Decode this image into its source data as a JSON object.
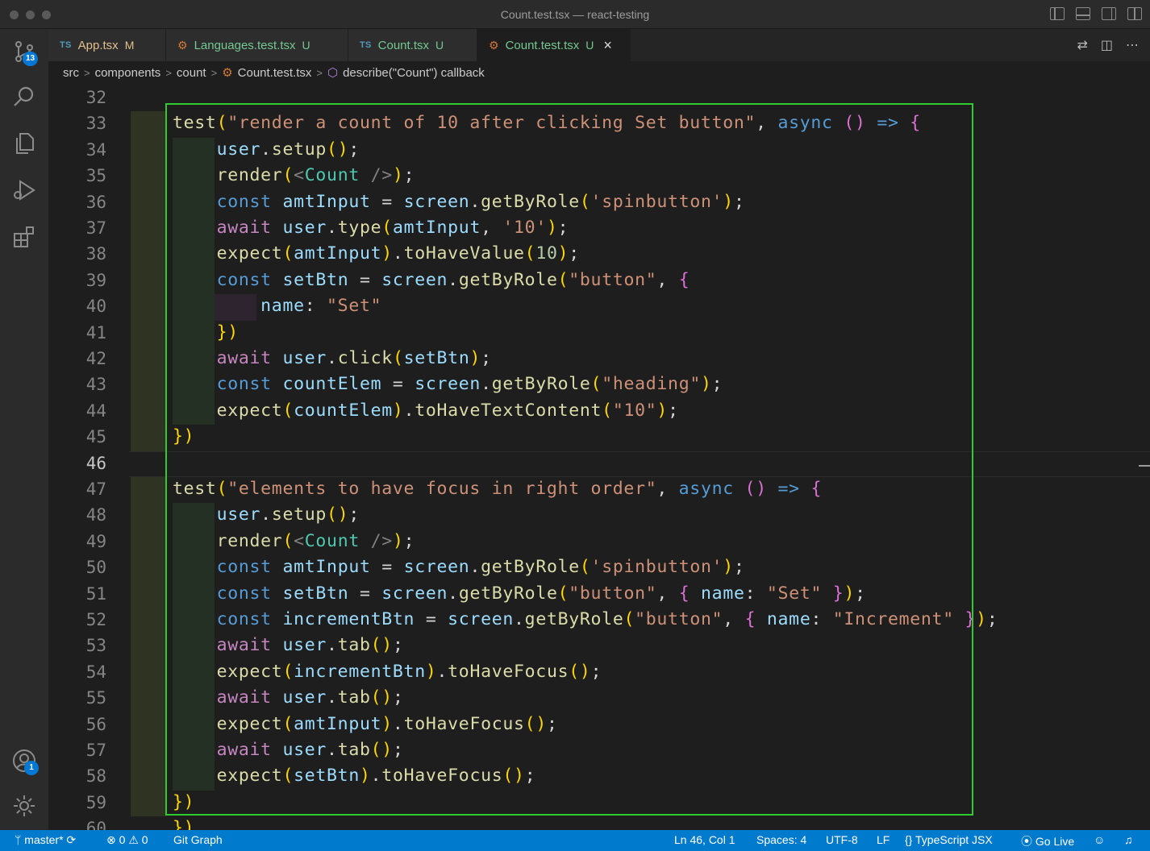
{
  "window": {
    "title": "Count.test.tsx — react-testing"
  },
  "activity_bar": {
    "source_control_badge": "13",
    "accounts_badge": "1"
  },
  "tabs": [
    {
      "lang": "TS",
      "name": "App.tsx",
      "status": "M",
      "active": false
    },
    {
      "lang": "gear",
      "name": "Languages.test.tsx",
      "status": "U",
      "active": false
    },
    {
      "lang": "TS",
      "name": "Count.tsx",
      "status": "U",
      "active": false
    },
    {
      "lang": "gear",
      "name": "Count.test.tsx",
      "status": "U",
      "active": true
    }
  ],
  "breadcrumb": {
    "parts": [
      "src",
      "components",
      "count",
      "Count.test.tsx",
      "describe(\"Count\") callback"
    ]
  },
  "editor": {
    "active_line": "46",
    "line_numbers": [
      "32",
      "33",
      "34",
      "35",
      "36",
      "37",
      "38",
      "39",
      "40",
      "41",
      "42",
      "43",
      "44",
      "45",
      "46",
      "47",
      "48",
      "49",
      "50",
      "51",
      "52",
      "53",
      "54",
      "55",
      "56",
      "57",
      "58",
      "59",
      "60"
    ],
    "lines": [
      "",
      "test(\"render a count of 10 after clicking Set button\", async () => {",
      "    user.setup();",
      "    render(<Count />);",
      "    const amtInput = screen.getByRole('spinbutton');",
      "    await user.type(amtInput, '10');",
      "    expect(amtInput).toHaveValue(10);",
      "    const setBtn = screen.getByRole(\"button\", {",
      "        name: \"Set\"",
      "    })",
      "    await user.click(setBtn);",
      "    const countElem = screen.getByRole(\"heading\");",
      "    expect(countElem).toHaveTextContent(\"10\");",
      "})",
      "",
      "test(\"elements to have focus in right order\", async () => {",
      "    user.setup();",
      "    render(<Count />);",
      "    const amtInput = screen.getByRole('spinbutton');",
      "    const setBtn = screen.getByRole(\"button\", { name: \"Set\" });",
      "    const incrementBtn = screen.getByRole(\"button\", { name: \"Increment\" });",
      "    await user.tab();",
      "    expect(incrementBtn).toHaveFocus();",
      "    await user.tab();",
      "    expect(amtInput).toHaveFocus();",
      "    await user.tab();",
      "    expect(setBtn).toHaveFocus();",
      "})",
      "})"
    ]
  },
  "statusbar": {
    "branch": "master*",
    "errors": "0",
    "warnings": "0",
    "git_graph": "Git Graph",
    "cursor": "Ln 46, Col 1",
    "spaces": "Spaces: 4",
    "encoding": "UTF-8",
    "eol": "LF",
    "language": "TypeScript JSX",
    "go_live": "Go Live"
  },
  "colors": {
    "selection_box": "#2ecc2e",
    "status_bar": "#007acc",
    "badge": "#0078d4"
  }
}
